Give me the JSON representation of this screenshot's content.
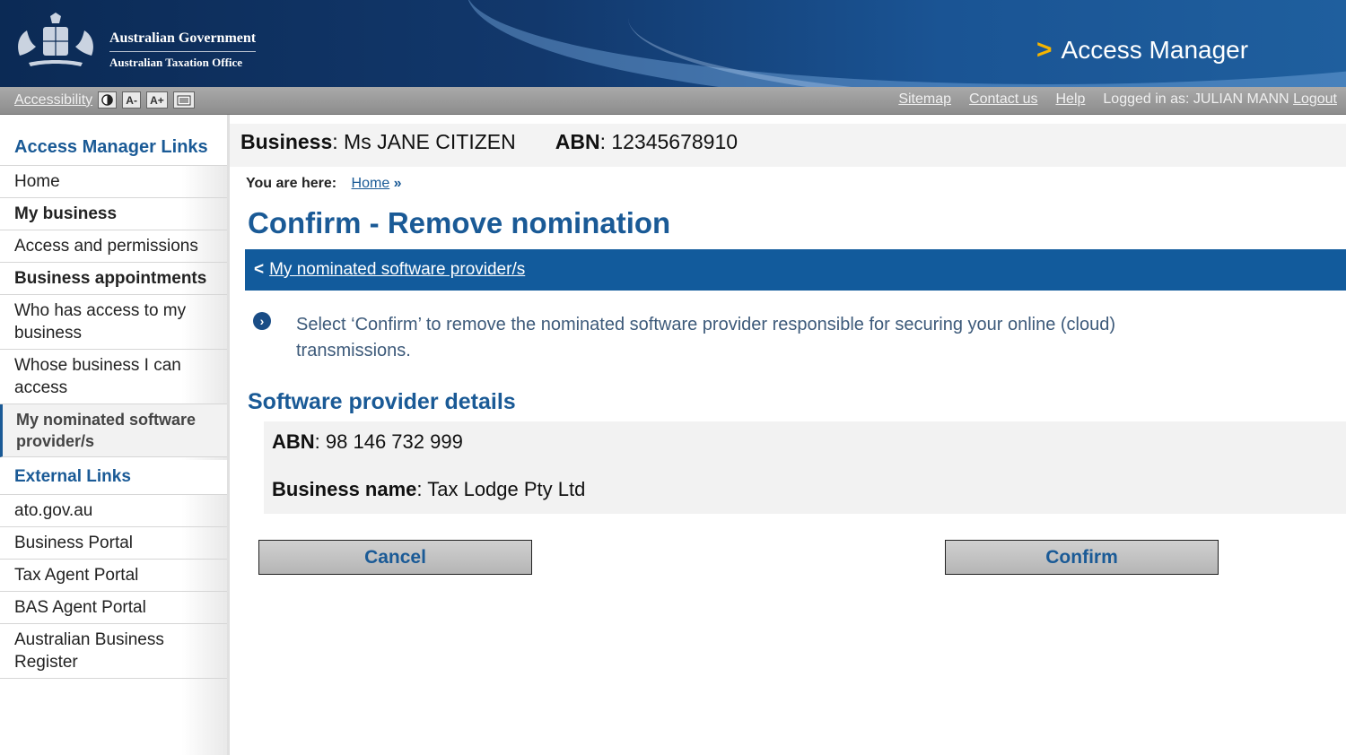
{
  "header": {
    "gov_line1": "Australian Government",
    "gov_line2": "Australian Taxation Office",
    "app_title": "Access Manager",
    "app_chevron": ">"
  },
  "utilbar": {
    "accessibility": "Accessibility",
    "buttons": [
      "",
      "A-",
      "A+",
      ""
    ],
    "links": [
      "Sitemap",
      "Contact us",
      "Help"
    ],
    "logged_in": "Logged in as: JULIAN MANN",
    "logout": "Logout"
  },
  "sidebar": {
    "heading": "Access Manager Links",
    "items": [
      {
        "label": "Home"
      },
      {
        "label": "My business"
      },
      {
        "label": "Access and permissions"
      },
      {
        "label": "Business appointments"
      },
      {
        "label": "Who has access to my business"
      },
      {
        "label": "Whose business I can access"
      },
      {
        "label": "My nominated software provider/s"
      }
    ],
    "external_heading": "External Links",
    "external": [
      {
        "label": "ato.gov.au"
      },
      {
        "label": "Business Portal"
      },
      {
        "label": "Tax Agent Portal"
      },
      {
        "label": "BAS Agent Portal"
      },
      {
        "label": "Australian Business Register"
      }
    ]
  },
  "business": {
    "label": "Business",
    "value": "Ms JANE CITIZEN",
    "abn_label": "ABN",
    "abn_value": "12345678910"
  },
  "breadcrumb": {
    "prefix": "You are here:",
    "home": "Home",
    "sep": "»"
  },
  "page_title": "Confirm - Remove nomination",
  "back_link": {
    "arrow": "<",
    "label": "My nominated software provider/s"
  },
  "info_text": "Select ‘Confirm’ to remove the nominated software provider responsible for securing your online (cloud) transmissions.",
  "section_title": "Software provider details",
  "provider": {
    "abn_label": "ABN",
    "abn_value": "98 146 732 999",
    "name_label": "Business name",
    "name_value": "Tax Lodge Pty Ltd"
  },
  "actions": {
    "cancel": "Cancel",
    "confirm": "Confirm"
  },
  "colors": {
    "brand_blue": "#1a5a96",
    "nav_bar": "#125b9c",
    "header_dark": "#0b2a55",
    "util_grey": "#9a9a9a"
  }
}
